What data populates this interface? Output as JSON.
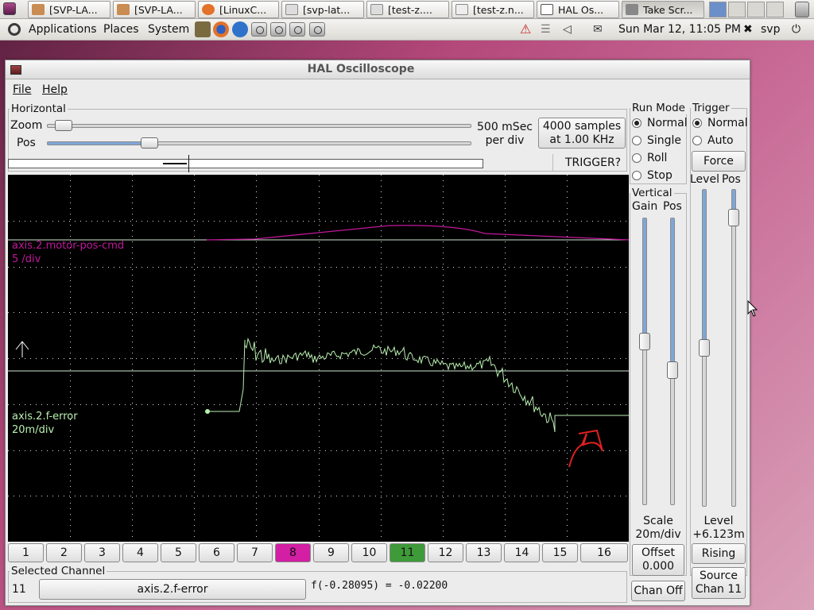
{
  "taskbar": {
    "tasks": [
      "[SVP-LA...",
      "[SVP-LA...",
      "[LinuxC...",
      "[svp-lat...",
      "[test-z....",
      "[test-z.n...",
      "HAL Os...",
      "Take Scr..."
    ]
  },
  "panel": {
    "menus": [
      "Applications",
      "Places",
      "System"
    ],
    "clock": "Sun Mar 12, 11:05 PM",
    "user": "svp"
  },
  "window": {
    "title": "HAL Oscilloscope",
    "menu_file": "File",
    "menu_help": "Help"
  },
  "horizontal": {
    "label": "Horizontal",
    "zoom_label": "Zoom",
    "pos_label": "Pos",
    "zoom_value": 0.02,
    "pos_value": 0.23,
    "rate_line1": "500 mSec",
    "rate_line2": "per div",
    "samples_line1": "4000 samples",
    "samples_line2": "at 1.00 KHz",
    "trigger_status": "TRIGGER?"
  },
  "run_mode": {
    "label": "Run Mode",
    "options": [
      "Normal",
      "Single",
      "Roll",
      "Stop"
    ],
    "selected": "Normal"
  },
  "trigger": {
    "label": "Trigger",
    "options": [
      "Normal",
      "Auto"
    ],
    "selected": "Normal",
    "force_label": "Force",
    "level_label": "Level",
    "pos_label": "Pos",
    "level_text": "Level",
    "level_value": "+6.123m",
    "edge_button": "Rising",
    "source_line1": "Source",
    "source_line2": "Chan 11"
  },
  "vertical": {
    "label": "Vertical",
    "gain_label": "Gain",
    "pos_label": "Pos",
    "scale_label": "Scale",
    "scale_value": "20m/div",
    "offset_label": "Offset",
    "offset_value": "0.000",
    "chan_off_label": "Chan Off"
  },
  "plot": {
    "colors": {
      "background": "#000000",
      "grid": "#d8d8d8",
      "ch8": "#c0189a",
      "ch11": "#b8f0b0"
    },
    "ch8_name": "axis.2.motor-pos-cmd",
    "ch8_scale": "5 /div",
    "ch11_name": "axis.2.f-error",
    "ch11_scale": "20m/div"
  },
  "channels": {
    "labels": [
      "1",
      "2",
      "3",
      "4",
      "5",
      "6",
      "7",
      "8",
      "9",
      "10",
      "11",
      "12",
      "13",
      "14",
      "15",
      "16"
    ],
    "active_colors": {
      "8": "#d21fa3",
      "11": "#3f9a3a"
    }
  },
  "selected_channel": {
    "label": "Selected Channel",
    "number": "11",
    "name": "axis.2.f-error",
    "readout": "f(-0.28095) = -0.02200"
  }
}
